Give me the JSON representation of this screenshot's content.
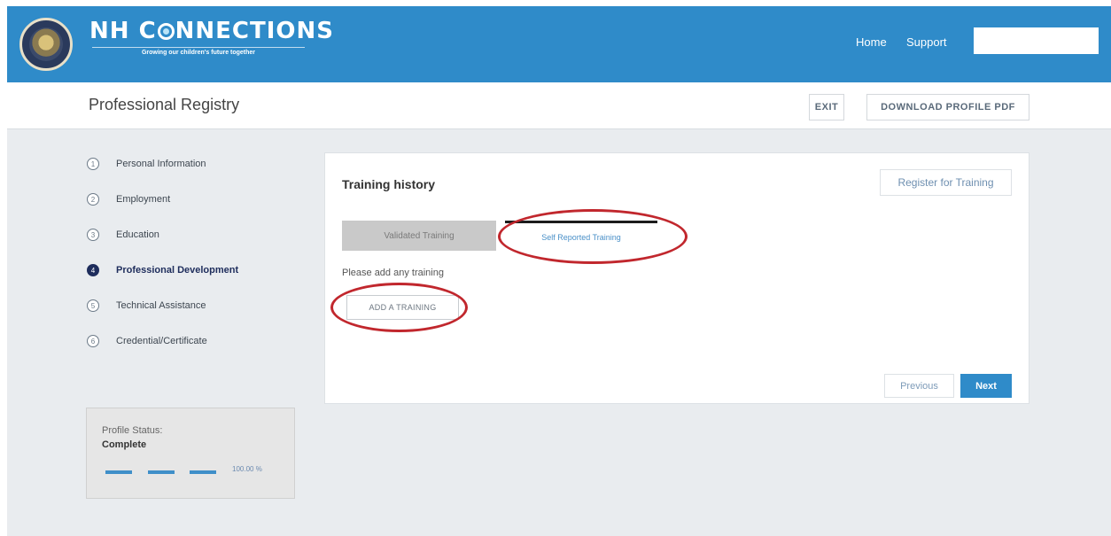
{
  "header": {
    "brand_prefix": "NH C",
    "brand_suffix": "NNECTIONS",
    "tagline": "Growing our children's future together",
    "nav": {
      "home": "Home",
      "support": "Support"
    },
    "search": {
      "value": "",
      "placeholder": ""
    },
    "colors": {
      "bar": "#2f8bc9"
    }
  },
  "titlebar": {
    "title": "Professional Registry",
    "exit_label": "EXIT",
    "download_label": "DOWNLOAD PROFILE PDF"
  },
  "stepper": {
    "steps": [
      {
        "num": "1",
        "label": "Personal Information",
        "active": false
      },
      {
        "num": "2",
        "label": "Employment",
        "active": false
      },
      {
        "num": "3",
        "label": "Education",
        "active": false
      },
      {
        "num": "4",
        "label": "Professional Development",
        "active": true
      },
      {
        "num": "5",
        "label": "Technical Assistance",
        "active": false
      },
      {
        "num": "6",
        "label": "Credential/Certificate",
        "active": false
      }
    ]
  },
  "profile_status": {
    "label": "Profile Status:",
    "value": "Complete",
    "percent_text": "100.00 %",
    "progress": 1.0
  },
  "main": {
    "title": "Training history",
    "register_label": "Register for Training",
    "tabs": [
      {
        "label": "Validated Training",
        "selected": false
      },
      {
        "label": "Self Reported Training",
        "selected": true
      }
    ],
    "hint": "Please add any training",
    "add_label": "ADD A TRAINING",
    "previous_label": "Previous",
    "next_label": "Next"
  },
  "annotations": {
    "highlight_color": "#c1272d"
  }
}
